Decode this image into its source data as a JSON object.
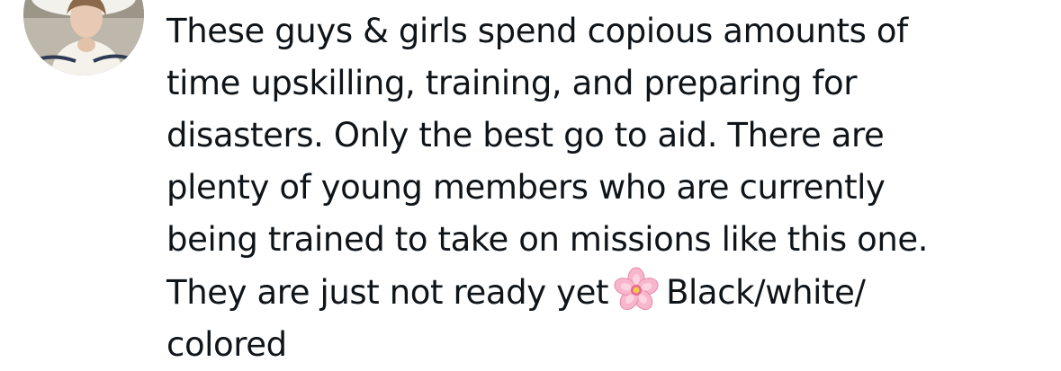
{
  "tweet": {
    "lines": [
      "These guys & girls spend copious amounts of",
      "time upskilling, training, and preparing for",
      "disasters. Only the best go to aid. There are",
      "plenty of young members who are currently",
      "being trained to take on missions like this one."
    ],
    "line6_before": "They are just not ready yet",
    "line6_after": "Black/white/",
    "line7": "colored",
    "emoji_icon": "cherry-blossom-icon",
    "text_color": "#0f1419",
    "emoji_petal_color": "#f7b6cc",
    "emoji_center_color": "#f2c94c"
  },
  "avatar": {
    "icon": "profile-photo"
  }
}
